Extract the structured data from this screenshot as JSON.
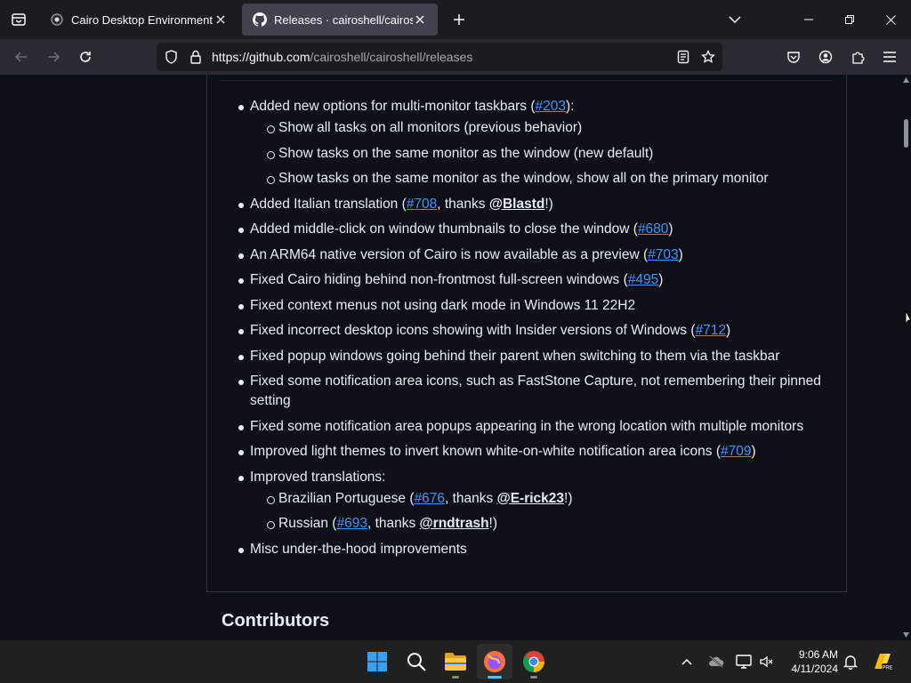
{
  "browser": {
    "tabs": [
      {
        "title": "Cairo Desktop Environment",
        "active": false
      },
      {
        "title": "Releases · cairoshell/cairoshell",
        "active": true
      }
    ],
    "url": {
      "host": "https://github.com",
      "path": "/cairoshell/cairoshell/releases"
    }
  },
  "release_notes": {
    "items": [
      {
        "text": "Added new options for multi-monitor taskbars (",
        "link": "#203",
        "tail": "):",
        "subitems": [
          {
            "text": "Show all tasks on all monitors (previous behavior)"
          },
          {
            "text": "Show tasks on the same monitor as the window (new default)"
          },
          {
            "text": "Show tasks on the same monitor as the window, show all on the primary monitor"
          }
        ]
      },
      {
        "text": "Added Italian translation (",
        "link": "#708",
        "mid": ", thanks ",
        "user": "@Blastd",
        "tail": "!)"
      },
      {
        "text": "Added middle-click on window thumbnails to close the window (",
        "link": "#680",
        "tail": ")"
      },
      {
        "text": "An ARM64 native version of Cairo is now available as a preview (",
        "link": "#703",
        "tail": ")"
      },
      {
        "text": "Fixed Cairo hiding behind non-frontmost full-screen windows (",
        "link": "#495",
        "tail": ")"
      },
      {
        "text": "Fixed context menus not using dark mode in Windows 11 22H2"
      },
      {
        "text": "Fixed incorrect desktop icons showing with Insider versions of Windows (",
        "link": "#712",
        "tail": ")"
      },
      {
        "text": "Fixed popup windows going behind their parent when switching to them via the taskbar"
      },
      {
        "text": "Fixed some notification area icons, such as FastStone Capture, not remembering their pinned setting"
      },
      {
        "text": "Fixed some notification area popups appearing in the wrong location with multiple monitors"
      },
      {
        "text": "Improved light themes to invert known white-on-white notification area icons (",
        "link": "#709",
        "tail": ")"
      },
      {
        "text": "Improved translations:",
        "subitems": [
          {
            "text": "Brazilian Portuguese (",
            "link": "#676",
            "mid": ", thanks ",
            "user": "@E-rick23",
            "tail": "!)"
          },
          {
            "text": "Russian (",
            "link": "#693",
            "mid": ", thanks ",
            "user": "@rndtrash",
            "tail": "!)"
          }
        ]
      },
      {
        "text": "Misc under-the-hood improvements"
      }
    ],
    "contributors_heading": "Contributors"
  },
  "taskbar": {
    "apps": [
      "start",
      "search",
      "file-explorer",
      "firefox",
      "chrome"
    ],
    "time": "9:06 AM",
    "date": "4/11/2024"
  },
  "colors": {
    "link": "#4493f8",
    "page_bg": "#0d1117",
    "taskbar_bg": "#202020"
  }
}
